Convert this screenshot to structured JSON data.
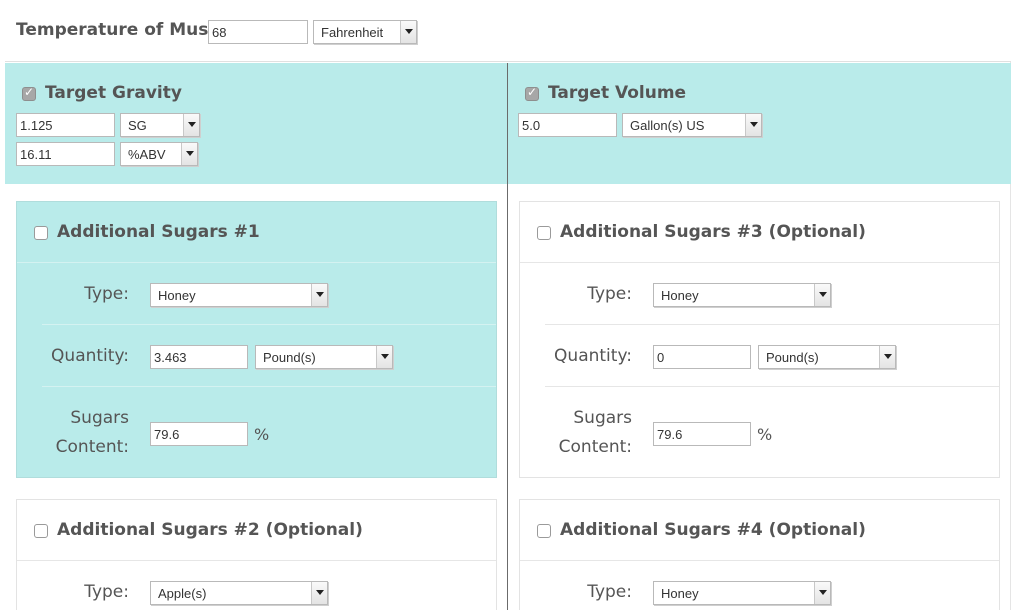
{
  "temperature": {
    "label": "Temperature of Must",
    "value": "68",
    "unit": "Fahrenheit"
  },
  "target_gravity": {
    "label": "Target Gravity",
    "checked": true,
    "gravity_value": "1.125",
    "gravity_unit": "SG",
    "abv_value": "16.11",
    "abv_unit": "%ABV"
  },
  "target_volume": {
    "label": "Target Volume",
    "checked": true,
    "value": "5.0",
    "unit": "Gallon(s) US"
  },
  "field_labels": {
    "type": "Type:",
    "quantity": "Quantity:",
    "sugars": "Sugars",
    "content": "Content:",
    "percent": "%"
  },
  "sugars": [
    {
      "title": "Additional Sugars #1",
      "checked": false,
      "type": "Honey",
      "quantity": "3.463",
      "quantity_unit": "Pound(s)",
      "sugars_content": "79.6"
    },
    {
      "title": "Additional Sugars #2 (Optional)",
      "checked": false,
      "type": "Apple(s)"
    },
    {
      "title": "Additional Sugars #3 (Optional)",
      "checked": false,
      "type": "Honey",
      "quantity": "0",
      "quantity_unit": "Pound(s)",
      "sugars_content": "79.6"
    },
    {
      "title": "Additional Sugars #4 (Optional)",
      "checked": false,
      "type": "Honey"
    }
  ],
  "colors": {
    "highlight": "#b9ebea",
    "text": "#555555",
    "border": "#e3e3e3"
  }
}
